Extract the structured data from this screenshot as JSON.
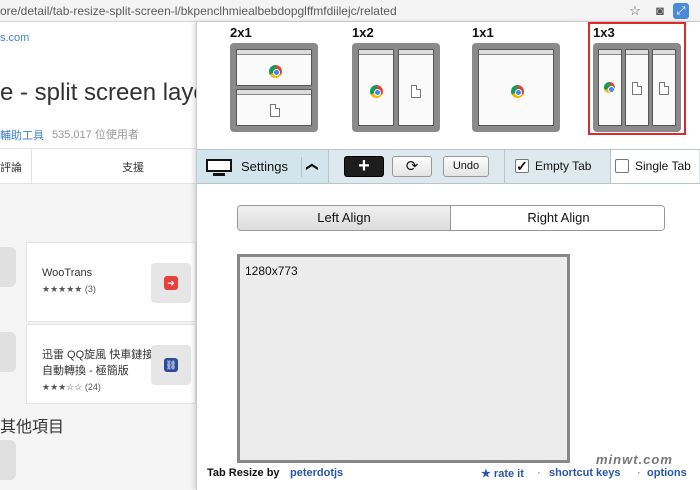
{
  "browser": {
    "url": "ore/detail/tab-resize-split-screen-l/bkpenclhmiealbebdopglffmfdiilejc/related",
    "icons": [
      "star-icon",
      "camera-icon",
      "extension-icon"
    ]
  },
  "background_page": {
    "title": "e - split screen layo",
    "publisher_link": "輔助工具",
    "users": "535,017 位使用者",
    "tabs": [
      "評論",
      "支援"
    ],
    "related": [
      {
        "name": "WooTrans",
        "rating": "★★★★★ (3)",
        "logo_color": "#e8403a"
      },
      {
        "name": "迅雷 QQ旋風 快車鏈接自動轉換 - 極簡版",
        "rating": "★★★☆☆ (24)",
        "logo_color": "#2d4a9c"
      }
    ],
    "other_heading": "其他項目",
    "site_link_suffix": "s.com"
  },
  "popup": {
    "layouts": [
      {
        "label": "2x1",
        "selected": false
      },
      {
        "label": "1x2",
        "selected": false
      },
      {
        "label": "1x1",
        "selected": false
      },
      {
        "label": "1x3",
        "selected": true
      }
    ],
    "toolbar": {
      "settings_label": "Settings",
      "caret": "❯",
      "add_label": "+",
      "reload_label": "⟳",
      "undo_label": "Undo",
      "empty_tab_label": "Empty Tab",
      "empty_tab_checked": true,
      "single_tab_label": "Single Tab",
      "single_tab_checked": false
    },
    "align": {
      "left_label": "Left Align",
      "right_label": "Right Align",
      "selected": "left"
    },
    "preview": {
      "resolution": "1280x773"
    },
    "footer": {
      "brand": "Tab Resize by",
      "author": "peterdotjs",
      "rate": "★ rate it",
      "separator": "·",
      "shortcuts": "shortcut keys",
      "options": "options"
    }
  },
  "watermark": "minwt.com"
}
